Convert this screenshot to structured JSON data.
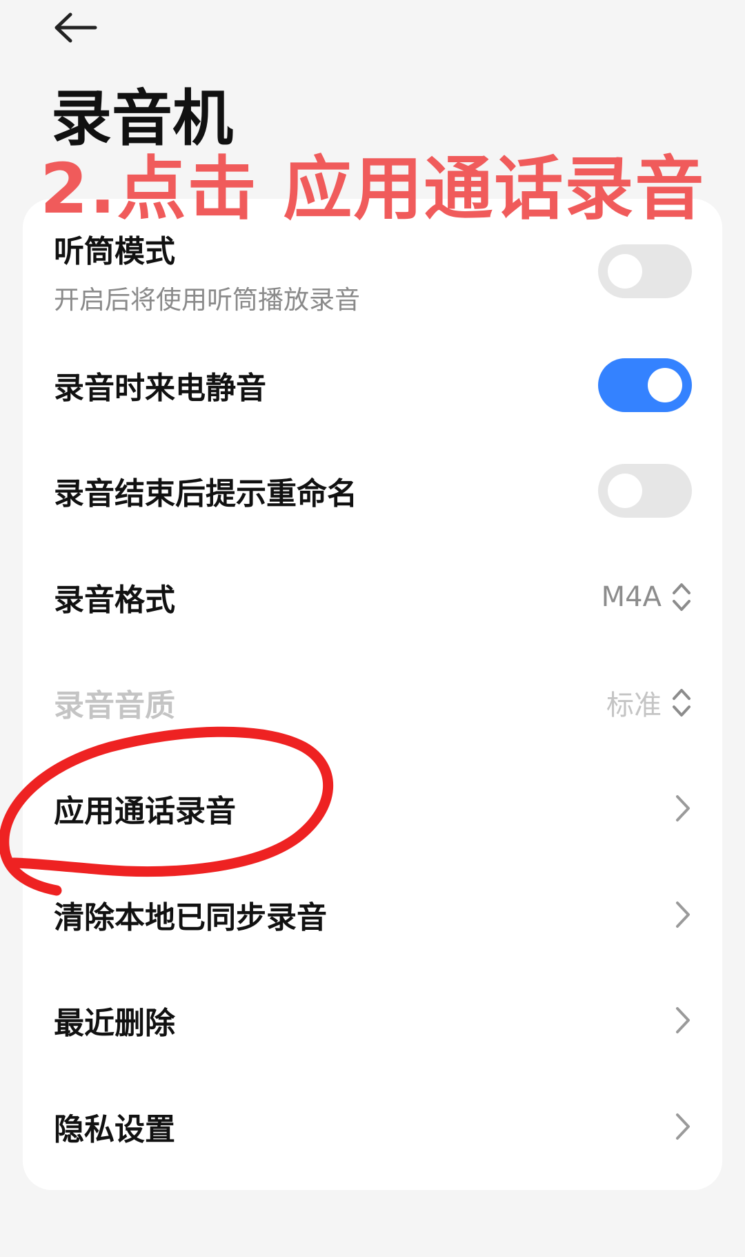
{
  "header": {
    "back_icon": "arrow-left-icon",
    "title": "录音机"
  },
  "annotation": {
    "text": "2.点击  应用通话录音",
    "color": "#f05b5b"
  },
  "settings": {
    "earpiece": {
      "label": "听筒模式",
      "sublabel": "开启后将使用听筒播放录音",
      "enabled": false
    },
    "mute_calls": {
      "label": "录音时来电静音",
      "enabled": true
    },
    "rename_prompt": {
      "label": "录音结束后提示重命名",
      "enabled": false
    },
    "format": {
      "label": "录音格式",
      "value": "M4A"
    },
    "quality": {
      "label": "录音音质",
      "value": "标准"
    },
    "call_recording": {
      "label": "应用通话录音"
    },
    "clear_synced": {
      "label": "清除本地已同步录音"
    },
    "recently_deleted": {
      "label": "最近删除"
    },
    "privacy": {
      "label": "隐私设置"
    }
  },
  "colors": {
    "toggle_on": "#3482ff",
    "toggle_off": "#e6e6e6",
    "background": "#f5f5f5",
    "card": "#ffffff"
  }
}
